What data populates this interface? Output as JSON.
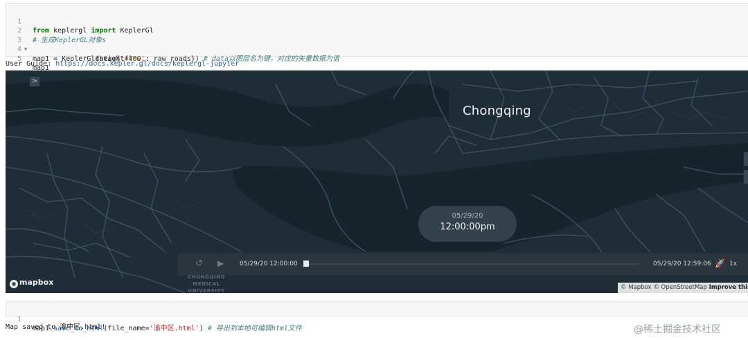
{
  "cell1": {
    "lines": [
      {
        "no": "1"
      },
      {
        "no": "2"
      },
      {
        "no": "3"
      },
      {
        "no": "4"
      },
      {
        "no": "5"
      }
    ],
    "l1_from": "from",
    "l1_mod": " keplergl ",
    "l1_import": "import",
    "l1_name": " KeplerGl",
    "l2_comment": "# 生成KeplerGL对象s",
    "l3_a": "map1 = KeplerGl(height=",
    "l3_num": "400",
    "l3_b": ",",
    "l4_a": "               data={",
    "l4_str": "'flow'",
    "l4_b": ": raw_roads}) ",
    "l4_comment": "# data以图层名为键，对应的矢量数据为值",
    "l5": "map1"
  },
  "output1": {
    "guide_label": "User Guide: ",
    "guide_link": "https://docs.kepler.gl/docs/keplergl-jupyter"
  },
  "map": {
    "toggle_label": ">",
    "city_label": "Chongqing",
    "time_bubble": {
      "date": "05/29/20",
      "time": "12:00:00pm"
    },
    "playback": {
      "start_label": "05/29/20 12:00:00",
      "end_label": "05/29/20 12:59:06",
      "speed": "1x",
      "reset_glyph": "↺",
      "play_glyph": "▶",
      "speed_glyph": "🚀",
      "progress": 0.0
    },
    "logo_text": "mapbox",
    "university_label": "CHONGQING MEDICAL UNIVERSITY",
    "attribution": {
      "mapbox": "© Mapbox",
      "osm": "© OpenStreetMap",
      "improve": "Improve this"
    },
    "colors": {
      "land": "#1f2d36",
      "water": "#17242c",
      "road": "#3e5563"
    }
  },
  "cell2": {
    "no": "1",
    "a": "map1.",
    "fn": "save_to_html",
    "b": "(file_name=",
    "str": "'渝中区.html'",
    "c": ") ",
    "comment": "# 导出到本地可编辑html文件"
  },
  "output2": {
    "text": "Map saved to 渝中区.html!"
  },
  "watermark": "@稀土掘金技术社区"
}
